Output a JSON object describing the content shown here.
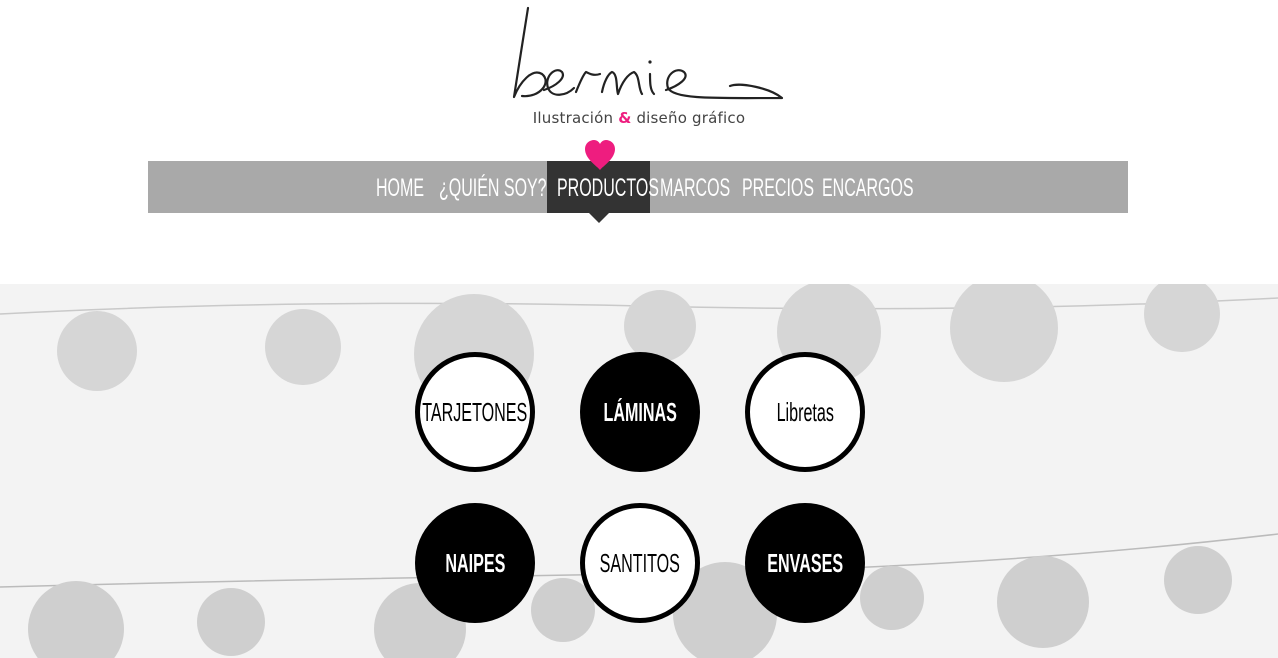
{
  "brand": {
    "logo_text": "bernie",
    "tagline_part1": "Ilustración",
    "tagline_amp": "&",
    "tagline_part2": "diseño gráfico",
    "accent_color": "#ee1d7f"
  },
  "nav": {
    "items": [
      {
        "label": "HOME",
        "active": false
      },
      {
        "label": "¿QUIÉN SOY?",
        "active": false
      },
      {
        "label": "PRODUCTOS",
        "active": true
      },
      {
        "label": "MARCOS",
        "active": false
      },
      {
        "label": "PRECIOS",
        "active": false
      },
      {
        "label": "ENCARGOS",
        "active": false
      }
    ],
    "active_icon": "heart-icon",
    "bar_color": "#a9a9a9",
    "active_color": "#333333"
  },
  "products": {
    "items": [
      {
        "label": "TARJETONES",
        "style": "outline"
      },
      {
        "label": "LÁMINAS",
        "style": "solid"
      },
      {
        "label": "Libretas",
        "style": "outline"
      },
      {
        "label": "NAIPES",
        "style": "solid"
      },
      {
        "label": "SANTITOS",
        "style": "outline"
      },
      {
        "label": "ENVASES",
        "style": "solid"
      }
    ]
  }
}
